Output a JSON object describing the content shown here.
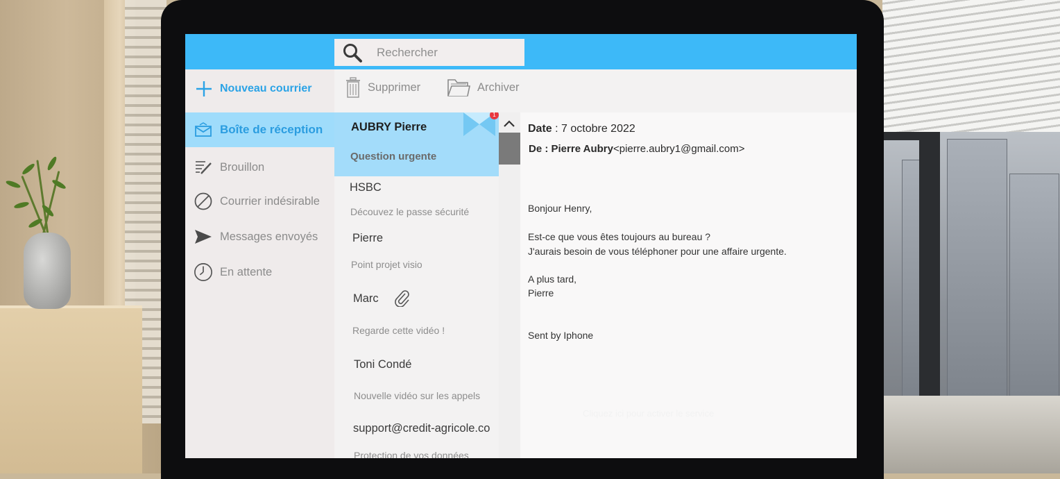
{
  "search": {
    "placeholder": "Rechercher"
  },
  "sidebar": {
    "new_mail_label": "Nouveau courrier",
    "items": [
      {
        "label": "Boîte de réception",
        "icon": "inbox-icon",
        "active": true
      },
      {
        "label": "Brouillon",
        "icon": "draft-icon",
        "active": false
      },
      {
        "label": "Courrier indésirable",
        "icon": "blocked-icon",
        "active": false
      },
      {
        "label": "Messages envoyés",
        "icon": "send-icon",
        "active": false
      },
      {
        "label": "En attente",
        "icon": "clock-icon",
        "active": false
      }
    ]
  },
  "toolbar": {
    "delete_label": "Supprimer",
    "archive_label": "Archiver"
  },
  "messages": [
    {
      "sender": "AUBRY Pierre",
      "subject": "Question urgente",
      "selected": true,
      "unread_count": "1"
    },
    {
      "sender": "HSBC",
      "subject": "Découvez le passe sécurité"
    },
    {
      "sender": "Pierre",
      "subject": "Point projet visio"
    },
    {
      "sender": "Marc",
      "subject": "Regarde cette vidéo !",
      "attachment": true
    },
    {
      "sender": "Toni Condé",
      "subject": "Nouvelle vidéo sur les appels"
    },
    {
      "sender": "support@credit-agricole.co",
      "subject": "Protection de vos données"
    }
  ],
  "reading": {
    "date_label": "Date",
    "date_value": " : 7 octobre 2022",
    "from_label": "De : Pierre Aubry",
    "from_email": "<pierre.aubry1@gmail.com>",
    "body": [
      "Bonjour Henry,",
      "Est-ce que vous êtes toujours au bureau ?",
      "J'aurais besoin de vous téléphoner pour une affaire urgente.",
      "A plus tard,",
      "Pierre",
      "Sent by Iphone"
    ],
    "faint_text": "Cliquez ici pour activer le service"
  },
  "colors": {
    "topbar": "#3db9f8",
    "accent": "#2ba3e6",
    "selected": "#a3dcfa",
    "badge": "#e8373f"
  }
}
